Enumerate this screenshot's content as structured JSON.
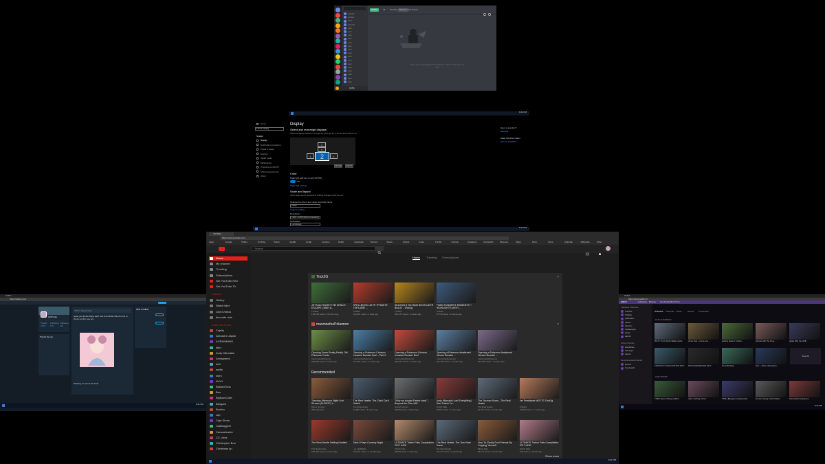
{
  "discord": {
    "tabs": [
      "Online",
      "All",
      "Pending",
      "Blocked",
      "Add Friend"
    ],
    "search_placeholder": "Search",
    "dm_header": "Friends",
    "empty_text": "There are no pending friend requests. Here's a Wumpus for now.",
    "user_label": "Griffin",
    "guild_colors": [
      "#7289da",
      "#f04747",
      "#43b581",
      "#faa61a",
      "#e67e22",
      "#9b59b6",
      "#1abc9c",
      "#e91e63",
      "#3498db",
      "#f1c40f",
      "#2ecc71",
      "#e74c3c",
      "#95a5a6",
      "#8e44ad",
      "#16a085"
    ],
    "dm_names": [
      "Activity",
      "Library",
      "Nitro",
      "Friends",
      "user",
      "user",
      "user",
      "user",
      "user",
      "user",
      "user",
      "user",
      "user",
      "user",
      "user",
      "user",
      "user",
      "user",
      "user",
      "user"
    ]
  },
  "settings": {
    "nav_top": "Home",
    "search_placeholder": "Find a setting",
    "section": "System",
    "nav_items": [
      "Display",
      "Notifications & actions",
      "Power & sleep",
      "Storage",
      "Tablet mode",
      "Multitasking",
      "Projecting to this PC",
      "Shared experiences",
      "About"
    ],
    "title": "Display",
    "subtitle": "Select and rearrange displays",
    "help": "Select a display below to change the settings for it. Press and hold (or select) a display, then drag to rearrange it.",
    "monitors": [
      "1",
      "3",
      "2",
      "4"
    ],
    "identify_label": "Identify",
    "detect_label": "Detect",
    "color_heading": "Color",
    "night_light_label": "Night light (will turn on at 9:00 PM)",
    "night_light_toggle": "Off",
    "night_light_settings": "Night light settings",
    "scale_heading": "Scale and layout",
    "scale_help": "Some apps won't respond to scaling changes until you close and reopen them.",
    "scale_label": "Change the size of text, apps, and other items",
    "scale_value": "100%",
    "custom_scaling": "Custom scaling",
    "resolution_label": "Resolution",
    "resolution_value": "1920 x 1080 (Recommended)",
    "orientation_label": "Orientation",
    "orientation_value": "Landscape",
    "right_q": "Have a question?",
    "right_link": "Get help",
    "right_q2": "Make Windows better",
    "right_link2": "Give us feedback"
  },
  "twitter": {
    "url": "https://twitter.com/",
    "tab_title": "Twitter",
    "profile_name": "Griff Gray",
    "stats_labels": [
      "Tweets",
      "Following",
      "Followers"
    ],
    "stats_values": [
      "2,561",
      "155",
      "146"
    ],
    "compose_placeholder": "What's happening?",
    "tweet_text": "Hope you all are doing well! Just a reminder that it's time to check out the new art~",
    "who_to_follow": "Who to follow",
    "trends_title": "Trends for you",
    "follow_label": "Follow",
    "reply_text": "Working on lots of fun stuff"
  },
  "youtube": {
    "url": "https://www.youtube.com",
    "tab_title": "YouTube",
    "bookmarks": [
      "Apps",
      "Google",
      "Twitter",
      "YouTube",
      "Twitch",
      "Reddit",
      "Gmail",
      "Amazon",
      "Netflix",
      "Facebook",
      "Discord",
      "Steam",
      "GitHub",
      "Imgur",
      "Tumblr",
      "Outlook",
      "Instagram",
      "DeviantArt",
      "Pinterest",
      "Maps",
      "Drive",
      "Docs",
      "Calendar",
      "Wikipedia",
      "Other"
    ],
    "search_placeholder": "Search",
    "tabs": [
      "Home",
      "Trending",
      "Subscriptions"
    ],
    "nav": [
      "Home",
      "My channel",
      "Trending",
      "Subscriptions",
      "Get YouTube Red",
      "Get YouTube TV"
    ],
    "library_heading": "LIBRARY",
    "library": [
      "History",
      "Watch later",
      "Liked videos",
      "favourite vids"
    ],
    "subs_heading": "SUBSCRIPTIONS",
    "subs": [
      "Cujelly",
      "Abroad in Japan",
      "AGRAMMING",
      "alpo",
      "Andy Milonakis",
      "Annagrams",
      "Arin",
      "asdfa",
      "astro",
      "AVVV",
      "BakaraTuna",
      "Ben",
      "BigbossCutie",
      "Bangam",
      "Bumbo",
      "cap",
      "Capt Stone",
      "CatBlogger2",
      "Cansaeleader",
      "CC Lines",
      "Christopher Bun",
      "Christmas up"
    ],
    "sections": [
      {
        "channel": "Trick2G",
        "videos": [
          {
            "title": "JEYS ACTIVATE! THE KENCH ESCAPE | IBEH A...",
            "ch": "Trick2G",
            "meta": "133,238 views • 23 hours ago",
            "c": "#3f6e3a"
          },
          {
            "title": "SPELLBOOK UDYR TP/SMITE TOPLANE! ...",
            "ch": "Trick2G",
            "meta": "146,287 views • 4 days ago",
            "c": "#b43d2c"
          },
          {
            "title": "SEASON 8 'HA RAID BOSS UDYR BUILD' - Trick2g",
            "ch": "Trick2G",
            "meta": "286,470 views • 2 weeks ago",
            "c": "#b8861e"
          },
          {
            "title": "PUBG FUNNIEST MOMENTS + HIGHLIGHTS WITH ...",
            "ch": "Trick2G",
            "meta": "56,738 views • 3 weeks ago",
            "c": "#3e5a7a"
          }
        ]
      },
      {
        "channel": "maxmoefoePokemon",
        "videos": [
          {
            "title": "Opening Some Really Really Old Pokemon Cards",
            "ch": "maxmoefoePokemon",
            "meta": "284,838 views • 5 days ago",
            "c": "#6d8f45"
          },
          {
            "title": "Opening a Pokemon Crimson Invasion Booster Box! - Part 2",
            "ch": "maxmoefoePokemon",
            "meta": "227,351 views • 2 weeks ago",
            "c": "#4a7fa8"
          },
          {
            "title": "Opening a Pokemon Crimson Invasion Booster Box!",
            "ch": "maxmoefoePokemon",
            "meta": "262,091 views • 2 weeks ago",
            "c": "#c24b3c"
          },
          {
            "title": "Opening a Pokemon Awakened Heroes Booster ...",
            "ch": "maxmoefoePokemon",
            "meta": "181,180 views • 3 weeks ago",
            "c": "#5c7fa2"
          },
          {
            "title": "Opening a Pokemon Awakened Heroes Booster ...",
            "ch": "maxmoefoePokemon",
            "meta": "241,069 views • 3 weeks ago",
            "c": "#7b6a8a"
          }
        ]
      },
      {
        "channel": "Recommended",
        "videos": [
          {
            "title": "Tuesday Afternoon Night Live Stream (11/28/17) L...",
            "ch": "Game Grumps",
            "meta": "395 watching",
            "c": "#8a5b3b"
          },
          {
            "title": "The Real Hustle: The Cash Card Switch",
            "ch": "The Real Hustle",
            "meta": "91,980 views • 5 years ago",
            "c": "#4a5c6e"
          },
          {
            "title": "\"Why we bought Parker back\" - Beyond the Pine #18",
            "ch": "Smosh Games",
            "meta": "39,891 views • 3 days ago",
            "c": "#6b6e70"
          },
          {
            "title": "Andy Milonakis Lost Everything | Best Twitch Fa...",
            "ch": "Twitch Fails",
            "meta": "45,407 views • 1 week ago",
            "c": "#8a3a3a"
          },
          {
            "title": "The Taxman Scam - The Real Hustle",
            "ch": "The Real Hustle",
            "meta": "61,237 views • 3 years ago",
            "c": "#5e6a78"
          },
          {
            "title": "Vet Pewdiepie MEETS Trick2g",
            "ch": "Trick2G",
            "meta": "23,866 views • 1 month ago",
            "c": "#b87a5a"
          },
          {
            "title": "The Real Hustle Getting Hustled",
            "ch": "The Real Hustle",
            "meta": "313,262 views • 3 years ago",
            "c": "#9a3a2a"
          },
          {
            "title": "Tyler1 Plays Comedy Night",
            "ch": "LoL Highlights",
            "meta": "146,347 views • 2 months ago",
            "c": "#7a4a3a"
          },
          {
            "title": "ULTIMATE Twitch Fails Compilation 2017 #429",
            "ch": "Twitch Fails",
            "meta": "98,592 views • 1 day ago",
            "c": "#b58a6a"
          },
          {
            "title": "The Real Hustle: The Torn Note Scam",
            "ch": "The Real Hustle",
            "meta": "131,373 views • 3 years ago",
            "c": "#5a6a7a"
          },
          {
            "title": "How To: Easily Fool Friends By Copying Yourself",
            "ch": "Mister Epic",
            "meta": "95,271 views • 3 years ago",
            "c": "#8a5a3a"
          },
          {
            "title": "ULTIMATE Twitch Fails Compilation 2017 #430",
            "ch": "Twitch Fails",
            "meta": "446 views • 3 weeks ago",
            "c": "#b07a8a"
          }
        ]
      }
    ],
    "show_more": "Show more"
  },
  "twitch": {
    "url": "https://www.twitch.tv/",
    "tab_title": "Twitch",
    "nav": [
      "Following",
      "Browse",
      "Get Desktop",
      "Try Prime"
    ],
    "tabs": [
      "Overview",
      "Channels",
      "Hosts",
      "Games",
      "Connected"
    ],
    "sidebar_heading": "Followed Channels",
    "channels": [
      "zilchard",
      "Trick2g",
      "pokimane",
      "xqcow",
      "ItsAsinx",
      "Sodapoppin",
      "alinity",
      "sacriel"
    ],
    "online_heading": "Online Friends",
    "friends": [
      "Drachinas",
      "Jeff Tiger",
      "sacriel"
    ],
    "recommended_heading": "Recommended Friends",
    "recommended": [
      "kuzcoz",
      "Greekgodx"
    ],
    "live_heading": "LIVE CHANNELS",
    "live": [
      {
        "t": "WoT | Turnt WoTs Battle cards",
        "c": "#5e6b7a"
      },
      {
        "t": "close that + come join ...",
        "c": "#6a5a3a"
      },
      {
        "t": "getting better | Follow ...",
        "c": "#4a6a3a"
      },
      {
        "t": "pubcat with the boys ...",
        "c": "#7a5a5a"
      },
      {
        "t": "gdaly bbft (no chill)",
        "c": "#3a3a5a"
      },
      {
        "t": "LETHALITY COLLECTION 2017",
        "c": "#3a5a6a"
      },
      {
        "t": "SOLO MARATHON 2017",
        "c": "#2a2a2a"
      },
      {
        "t": "NeverEnding",
        "c": "#3a6a5a"
      },
      {
        "t": "Zoe + other champions ...",
        "c": "#2a3a5a"
      }
    ],
    "view_all": "View All",
    "hosts_heading": "LIVE HOSTS",
    "hosts": [
      {
        "t": "TSM | Zyra nothing stuffed",
        "c": "#3a5a3a"
      },
      {
        "t": "draw nothing indoor",
        "c": "#6a4a5a"
      },
      {
        "t": "TSM | Bjergsen testing stuff",
        "c": "#3a3a6a"
      },
      {
        "t": "House testing minimization",
        "c": "#5a5a5a"
      },
      {
        "t": "SteveStrol testing run",
        "c": "#7a3a3a"
      }
    ]
  },
  "taskbar": {
    "clock": "6:41 PM",
    "date": "11/28/2017"
  }
}
